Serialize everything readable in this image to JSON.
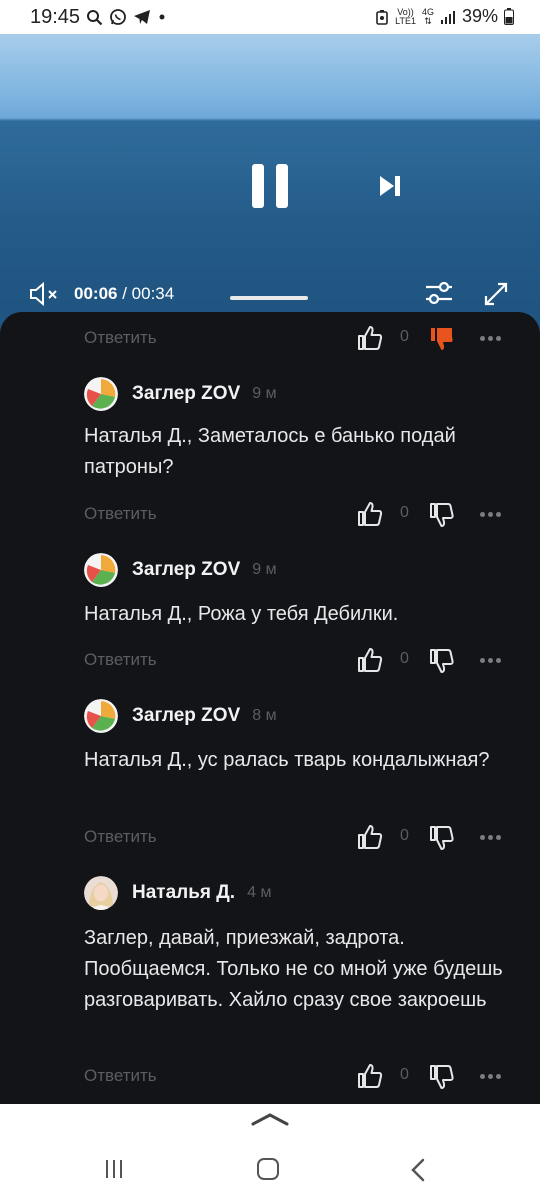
{
  "status_bar": {
    "time": "19:45",
    "left_icons": [
      "search-icon",
      "whatsapp-icon",
      "telegram-icon",
      "dot-icon"
    ],
    "volte_top": "Vo))",
    "volte_bottom": "LTE1",
    "network": "4G",
    "battery_percent": "39%"
  },
  "video": {
    "current_time": "00:06",
    "separator": " / ",
    "duration": "00:34",
    "progress": 0.18
  },
  "comments": [
    {
      "author": "Заглер ZOV",
      "age": "9 м",
      "text": "Наталья Д., Заметалось е банько подай патроны?",
      "likes": "0"
    },
    {
      "author": "Заглер ZOV",
      "age": "9 м",
      "text": "Наталья Д., Рожа у тебя Дебилки.",
      "likes": "0"
    },
    {
      "author": "Заглер ZOV",
      "age": "8 м",
      "text": "Наталья Д., ус ралась тварь кондалыжная?",
      "likes": "0"
    },
    {
      "author": "Наталья Д.",
      "age": "4 м",
      "text": "Заглер, давай, приезжай, задрота. Пообщаемся. Только не со мной уже будешь разговаривать. Хайло сразу свое закроешь",
      "likes": "0"
    }
  ],
  "top_action": {
    "reply": "Ответить",
    "likes": "0",
    "dislike_active": true
  },
  "reply_label": "Ответить",
  "colors": {
    "panel_bg": "#131418",
    "muted": "#5b5d63",
    "dislike_active": "#e8541e"
  }
}
